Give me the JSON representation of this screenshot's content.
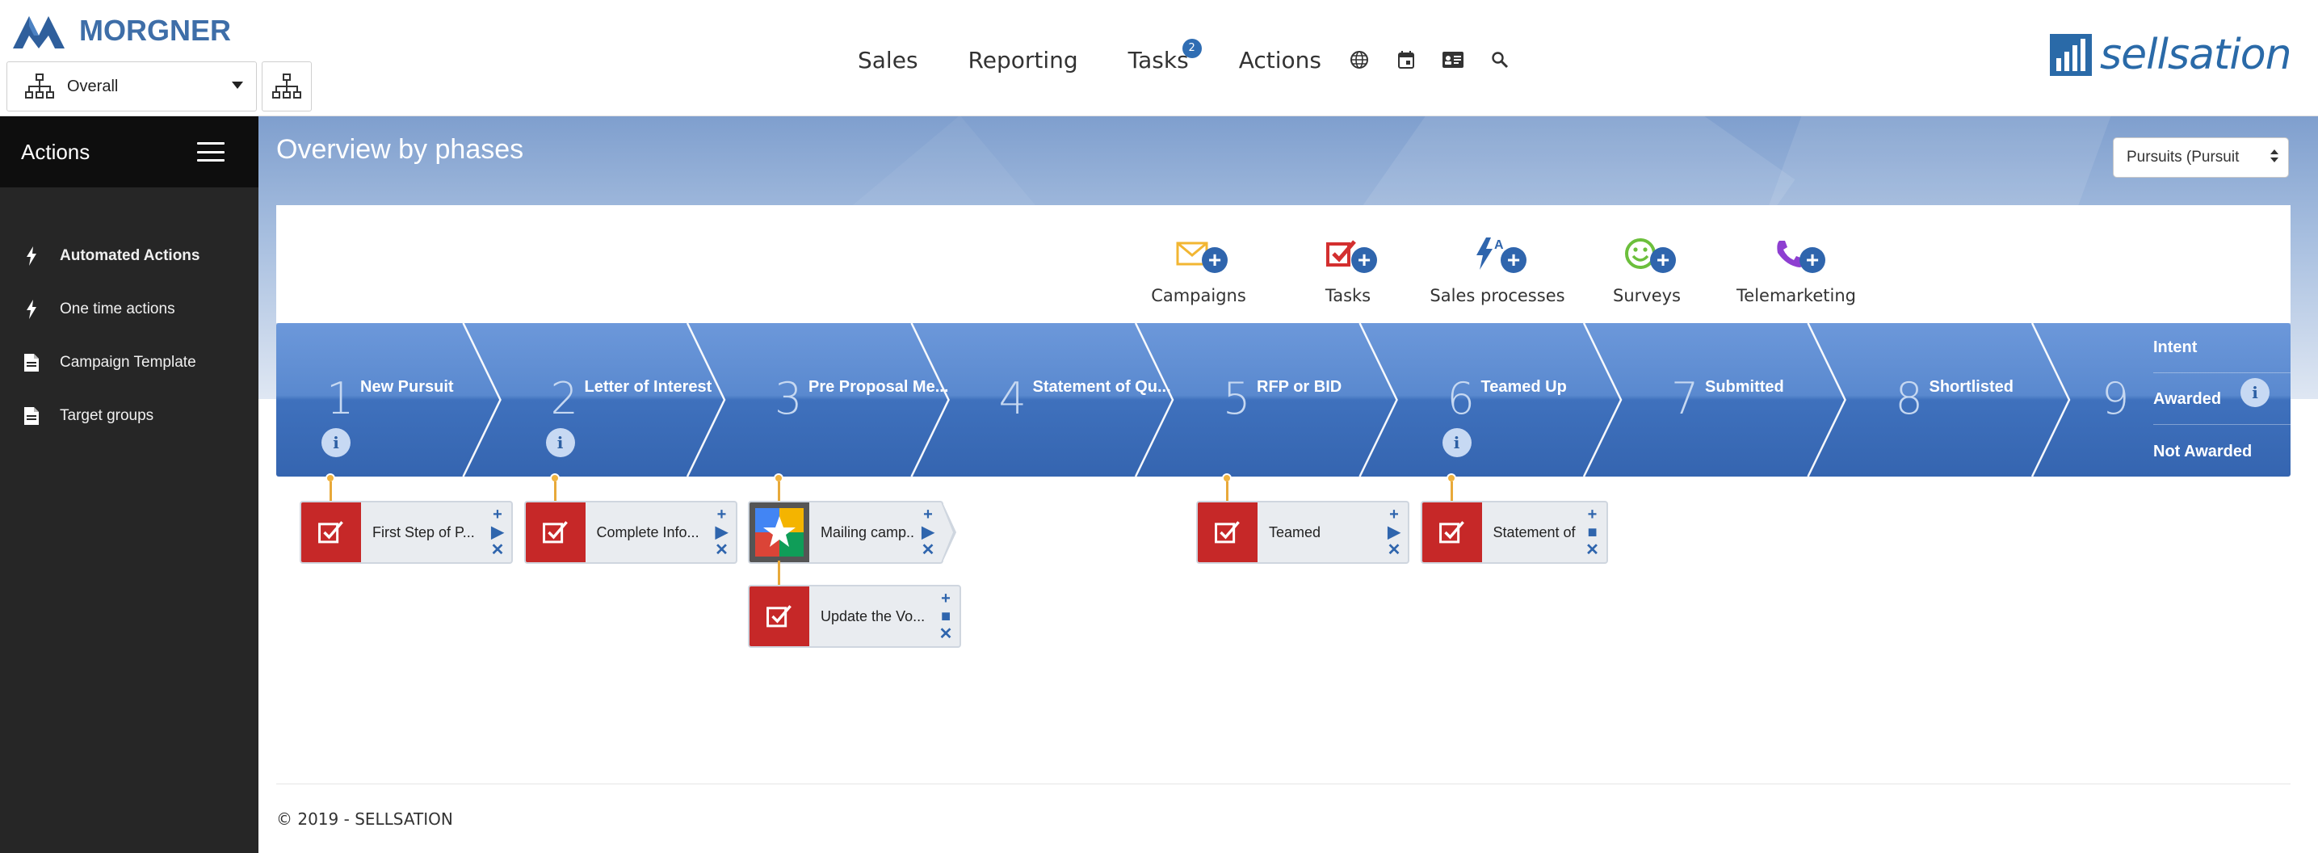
{
  "header": {
    "logo_text": "MORGNER",
    "context_select": {
      "value": "Overall"
    },
    "nav": [
      {
        "label": "Sales"
      },
      {
        "label": "Reporting"
      },
      {
        "label": "Tasks",
        "badge": "2"
      },
      {
        "label": "Actions"
      }
    ],
    "nav_icons": [
      "globe-icon",
      "calendar-icon",
      "contact-card-icon",
      "search-icon"
    ],
    "brand_text": "sellsation"
  },
  "sidebar": {
    "title": "Actions",
    "items": [
      {
        "label": "Automated Actions",
        "icon": "bolt-icon",
        "active": true
      },
      {
        "label": "One time actions",
        "icon": "bolt-icon",
        "active": false
      },
      {
        "label": "Campaign Template",
        "icon": "document-icon",
        "active": false
      },
      {
        "label": "Target groups",
        "icon": "document-icon",
        "active": false
      }
    ]
  },
  "main": {
    "title": "Overview by phases",
    "pursuit_select": {
      "value": "Pursuits (Pursuit"
    },
    "tools": [
      {
        "label": "Campaigns",
        "icon": "envelope-icon",
        "color": "#f2b632"
      },
      {
        "label": "Tasks",
        "icon": "task-check-icon",
        "color": "#d32f2f"
      },
      {
        "label": "Sales processes",
        "icon": "bolt-a-icon",
        "color": "#2f65ad"
      },
      {
        "label": "Surveys",
        "icon": "smiley-icon",
        "color": "#6cbf3c"
      },
      {
        "label": "Telemarketing",
        "icon": "phone-icon",
        "color": "#8e3fd1"
      }
    ],
    "phases": [
      {
        "num": "1",
        "name": "New Pursuit",
        "info": "i"
      },
      {
        "num": "2",
        "name": "Letter of Interest",
        "info": "i"
      },
      {
        "num": "3",
        "name": "Pre Proposal Me...",
        "info": ""
      },
      {
        "num": "4",
        "name": "Statement of Qu...",
        "info": ""
      },
      {
        "num": "5",
        "name": "RFP or BID",
        "info": ""
      },
      {
        "num": "6",
        "name": "Teamed Up",
        "info": "i"
      },
      {
        "num": "7",
        "name": "Submitted",
        "info": ""
      },
      {
        "num": "8",
        "name": "Shortlisted",
        "info": ""
      },
      {
        "num": "9",
        "name": "",
        "info": "i"
      }
    ],
    "phase9_options": [
      "Intent",
      "Awarded",
      "Not Awarded"
    ],
    "cards": [
      {
        "phase": 1,
        "label": "First Step of P...",
        "icon": "task-check-icon",
        "actions": [
          "+",
          "▶",
          "✕"
        ]
      },
      {
        "phase": 2,
        "label": "Complete Info...",
        "icon": "task-check-icon",
        "actions": [
          "+",
          "▶",
          "✕"
        ]
      },
      {
        "phase": 3,
        "label": "Mailing camp...",
        "icon": "google-star-icon",
        "actions": [
          "+",
          "▶",
          "✕"
        ]
      },
      {
        "phase": 3,
        "label": "Update the Vo...",
        "icon": "task-check-icon",
        "actions": [
          "+",
          "■",
          "✕"
        ]
      },
      {
        "phase": 5,
        "label": "Teamed",
        "icon": "task-check-icon",
        "actions": [
          "+",
          "▶",
          "✕"
        ]
      },
      {
        "phase": 6,
        "label": "Statement of ...",
        "icon": "task-check-icon",
        "actions": [
          "+",
          "■",
          "✕"
        ]
      }
    ],
    "footer": "© 2019 - SELLSATION"
  }
}
